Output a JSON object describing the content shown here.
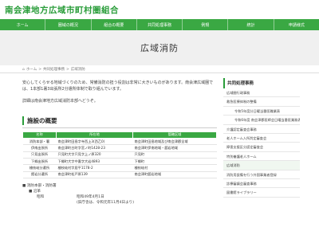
{
  "site": {
    "title": "南会津地方広域市町村圏組合"
  },
  "nav": {
    "items": [
      "ホーム",
      "圏域の概況",
      "組合の概要",
      "共同処理事務",
      "例規",
      "統計",
      "申請様式"
    ]
  },
  "page": {
    "title": "広域消防"
  },
  "breadcrumb": {
    "home": "ホーム",
    "sep": ">",
    "level1": "共同処理事務",
    "level2": "広域消防"
  },
  "main": {
    "intro": "安心してくらせる地域づくりのため、常備消防の担う役割は非常に大きいものがあります。南会津広域圏では、1本部1署3出張所2分遣所体制で取り組んでいます。",
    "detail": "詳細は南会津地方広域消防本部へどうぞ。",
    "section_title": "施設の概要",
    "table": {
      "headers": [
        "名称",
        "所在地",
        "管轄区域"
      ],
      "rows": [
        [
          "消防本部・署",
          "南会津町田島字寺西上3(西乙0)",
          "南会津町田島地域及び南会津郡全域"
        ],
        [
          "伊南出張所",
          "南会津町古町字宮ノ町1428-23",
          "南会津町伊南地域・舘岩地域"
        ],
        [
          "只見出張所",
          "只見町大字只見字上ノ原320",
          "只見町"
        ],
        [
          "下郷出張所",
          "下郷町大字中妻字大岩4893",
          "下郷町"
        ],
        [
          "檜枝岐分遣所",
          "檜枝岐村字居平1178-2",
          "檜枝岐村"
        ],
        [
          "館岩分遣所",
          "南会津町松戸原139",
          "南会津町舘岩地域"
        ]
      ]
    },
    "bullets": {
      "heading": "消防本部・消防署",
      "item": "■ 沿革",
      "label": "昭和",
      "value1": "昭和49年4月1日",
      "value2": "(旧庁舎は、令和元年11月4日より)"
    }
  },
  "sidebar": {
    "heading": "共同処理事務",
    "items": [
      {
        "label": "広域圏行政事務",
        "indent": false
      },
      {
        "label": "救急医療体制の整備",
        "indent": false
      },
      {
        "label": "令和5年度分日曜当番医職業表",
        "indent": true
      },
      {
        "label": "令和6年度 南会津郡医師会日曜当番医業務表",
        "indent": true
      },
      {
        "label": "介護認定審査会事務",
        "indent": false
      },
      {
        "label": "老人ホーム入所判定審査会",
        "indent": false
      },
      {
        "label": "障害支援区分認定審査会",
        "indent": false
      },
      {
        "label": "特別養護老人ホーム",
        "indent": false
      },
      {
        "label": "広域消防",
        "indent": false
      },
      {
        "label": "消防用設備を行う外国事業者登録",
        "indent": false
      },
      {
        "label": "診療審議会審査事務",
        "indent": false
      },
      {
        "label": "図書館ライブラリー",
        "indent": false
      }
    ]
  },
  "colors": {
    "brand": "#3aa843",
    "title": "#2a9d3a"
  }
}
